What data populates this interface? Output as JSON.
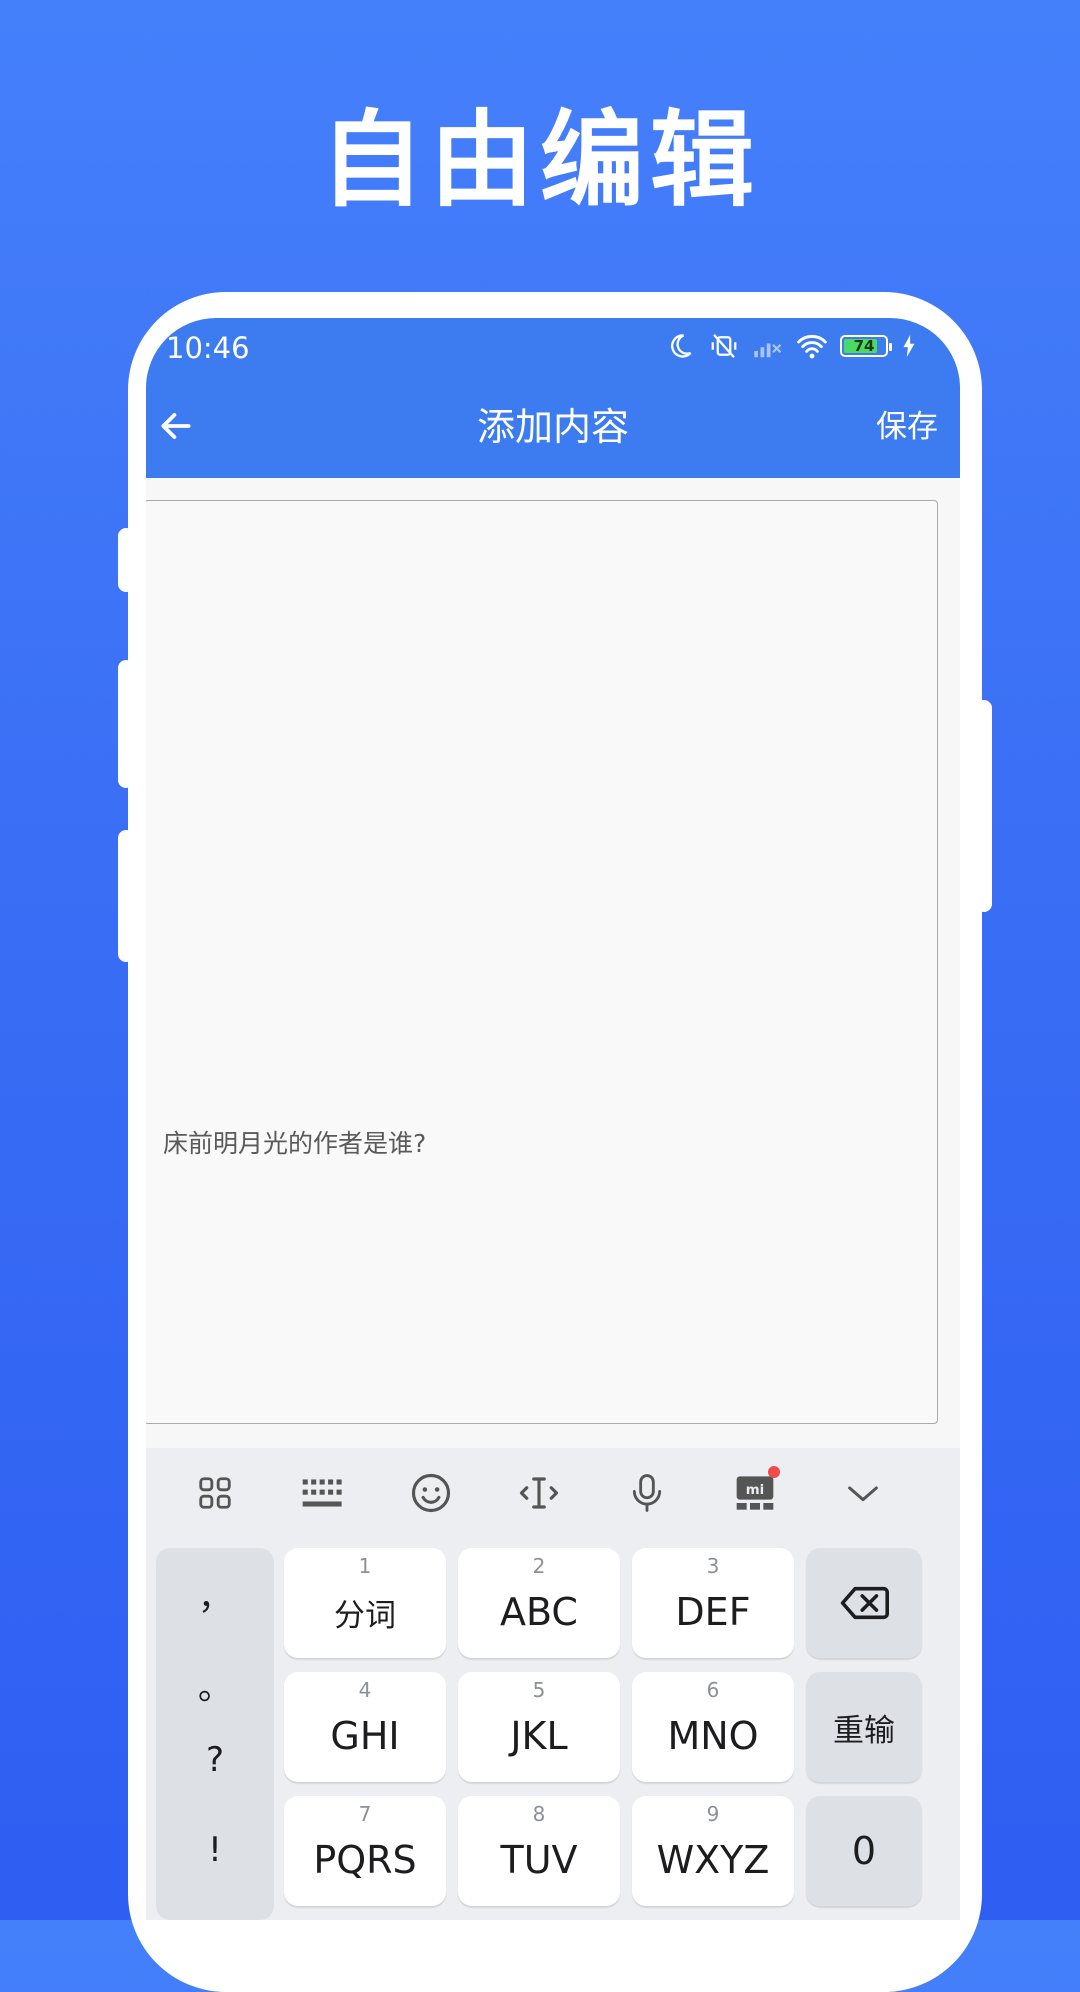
{
  "headline": "自由编辑",
  "status_bar": {
    "time": "10:46",
    "battery": "74",
    "battery_level": 0.74,
    "icons": [
      "moon-icon",
      "mute-icon",
      "signal-off-icon",
      "wifi-icon",
      "battery-icon",
      "charging-icon"
    ]
  },
  "appbar": {
    "title": "添加内容",
    "save_label": "保存"
  },
  "editor": {
    "text": "床前明月光的作者是谁?"
  },
  "keyboard": {
    "toolbar": [
      "grid-icon",
      "keyboard-icon",
      "emoji-icon",
      "cursor-icon",
      "microphone-icon",
      "mi-icon",
      "chevron-down-icon"
    ],
    "punctuation": [
      "，",
      "。",
      "?",
      "!"
    ],
    "keys": [
      {
        "num": "1",
        "label": "分词"
      },
      {
        "num": "2",
        "label": "ABC"
      },
      {
        "num": "3",
        "label": "DEF"
      },
      {
        "num": "4",
        "label": "GHI"
      },
      {
        "num": "5",
        "label": "JKL"
      },
      {
        "num": "6",
        "label": "MNO"
      },
      {
        "num": "7",
        "label": "PQRS"
      },
      {
        "num": "8",
        "label": "TUV"
      },
      {
        "num": "9",
        "label": "WXYZ"
      }
    ],
    "reenter_label": "重输",
    "zero_label": "0"
  },
  "colors": {
    "background": "#3a6ef5",
    "appbar": "#3c7cf0",
    "keyboard": "#eceef1"
  }
}
